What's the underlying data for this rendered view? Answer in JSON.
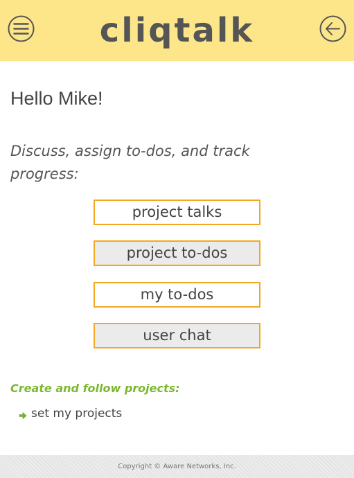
{
  "header": {
    "logo": "cliqtalk",
    "background": "#fde68a"
  },
  "main": {
    "greeting": "Hello Mike!",
    "tagline": "Discuss, assign to-dos, and track progress:",
    "buttons": [
      {
        "label": "project talks"
      },
      {
        "label": "project to-dos"
      },
      {
        "label": "my to-dos"
      },
      {
        "label": "user chat"
      }
    ],
    "section_title": "Create and follow projects:",
    "links": [
      {
        "label": "set my projects",
        "icon": "green-arrow-icon"
      }
    ]
  },
  "footer": {
    "copyright": "Copyright © Aware Networks, Inc."
  },
  "colors": {
    "accent_border": "#f5a623",
    "section_green": "#7cb82f",
    "text": "#555555"
  }
}
